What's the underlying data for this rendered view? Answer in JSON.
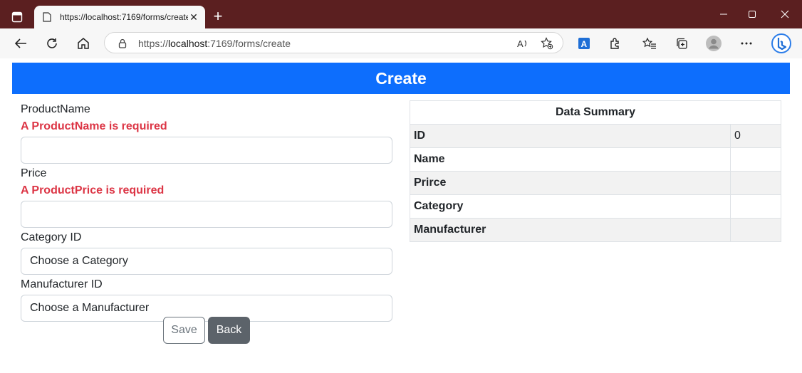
{
  "browser": {
    "tab_title": "https://localhost:7169/forms/create",
    "url_prefix": "https://",
    "url_host": "localhost",
    "url_rest": ":7169/forms/create"
  },
  "page": {
    "title": "Create"
  },
  "form": {
    "product_name_label": "ProductName",
    "product_name_error": "A ProductName is required",
    "product_name_value": "",
    "price_label": "Price",
    "price_error": "A ProductPrice is required",
    "price_value": "",
    "category_label": "Category ID",
    "category_selected": "Choose a Category",
    "manufacturer_label": "Manufacturer ID",
    "manufacturer_selected": "Choose a Manufacturer",
    "save_label": "Save",
    "back_label": "Back"
  },
  "summary": {
    "heading": "Data Summary",
    "rows": [
      {
        "key": "ID",
        "value": "0"
      },
      {
        "key": "Name",
        "value": ""
      },
      {
        "key": "Prirce",
        "value": ""
      },
      {
        "key": "Category",
        "value": ""
      },
      {
        "key": "Manufacturer",
        "value": ""
      }
    ]
  },
  "colors": {
    "header_bg": "#0d6efd",
    "error": "#dc3545",
    "titlebar": "#5b1f20"
  },
  "icons": [
    "tab-actions-icon",
    "page-favicon",
    "close-icon",
    "plus-icon",
    "minimize-icon",
    "maximize-icon",
    "window-close-icon",
    "back-icon",
    "refresh-icon",
    "home-icon",
    "lock-icon",
    "read-aloud-icon",
    "add-favorite-icon",
    "translate-icon",
    "extensions-icon",
    "favorites-icon",
    "collections-icon",
    "profile-icon",
    "more-icon",
    "bing-icon"
  ]
}
